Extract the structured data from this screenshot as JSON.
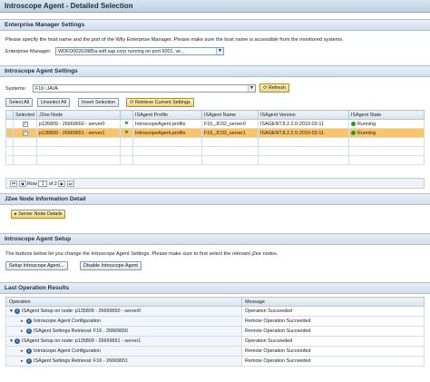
{
  "window": {
    "title": "Introscope Agent - Detailed Selection"
  },
  "em_settings": {
    "header": "Enterprise Manager Settings",
    "description": "Please specify the host name and the port of the Wily Enterprise Manager. Please make sure the host name is accessible from the monitored systems.",
    "label": "Enterprise Manager:",
    "value": "WDFD00262885a.wdf.sap.corp running on port 6001, ve..."
  },
  "agent_settings": {
    "header": "Introscope Agent Settings",
    "systems_label": "Systems:",
    "systems_value": "F16~JAVA",
    "refresh_label": "Refresh",
    "buttons": {
      "select_all": "Select All",
      "unselect_all": "Unselect All",
      "invert": "Invert Selection",
      "retrieve": "Retrieve Current Settings"
    },
    "columns": [
      "Selected",
      "J2ee Node",
      "ISAgent Profile",
      "ISAgent Name",
      "ISAgent Version",
      "ISAgent State"
    ],
    "rows": [
      {
        "selected": true,
        "node": "p135809 - 26669650 - server0",
        "profile": "IntroscopeAgent.profile",
        "name": "F16_JC02_server0",
        "version": "ISAGENT.8.2.2.0-2010-03-11",
        "state": "Running"
      },
      {
        "selected": true,
        "node": "p135809 - 26669651 - server1",
        "profile": "IntroscopeAgent.profile",
        "name": "F16_JC02_server1",
        "version": "ISAGENT.8.2.2.0-2010-03-11",
        "state": "Running"
      }
    ],
    "pager": {
      "row_label": "Row",
      "row_value": "1",
      "of_label": "of 2"
    }
  },
  "node_info": {
    "header": "J2ee Node Information Detail",
    "button": "Server Node Details"
  },
  "agent_setup": {
    "header": "Introscope Agent Setup",
    "description": "The buttons below let you change the Introscope Agent Settings. Please make sure to first select the relevant j2ee nodes.",
    "setup_button": "Setup Introscope Agent...",
    "disable_button": "Disable Introscope Agent"
  },
  "results": {
    "header": "Last Operation Results",
    "columns": [
      "Operation",
      "Message"
    ],
    "rows": [
      {
        "level": 0,
        "operation": "ISAgent Setup on node: p135809 - 26669650 - server0",
        "message": "Operation Succeeded"
      },
      {
        "level": 1,
        "operation": "Introscope Agent Configuration",
        "message": "Remote Operation Succeeded"
      },
      {
        "level": 1,
        "operation": "ISAgent Settings Retrieval: F16 - 26669650",
        "message": "Remote Operation Succeeded"
      },
      {
        "level": 0,
        "operation": "ISAgent Setup on node: p135809 - 26669651 - server1",
        "message": "Operation Succeeded"
      },
      {
        "level": 1,
        "operation": "Introscope Agent Configuration",
        "message": "Remote Operation Succeeded"
      },
      {
        "level": 1,
        "operation": "ISAgent Settings Retrieval: F16 - 26669651",
        "message": "Remote Operation Succeeded"
      }
    ]
  },
  "colors": {
    "selected_row": "#f7c56f",
    "running": "#1f9a2a",
    "header_bg": "#d1dfec"
  }
}
